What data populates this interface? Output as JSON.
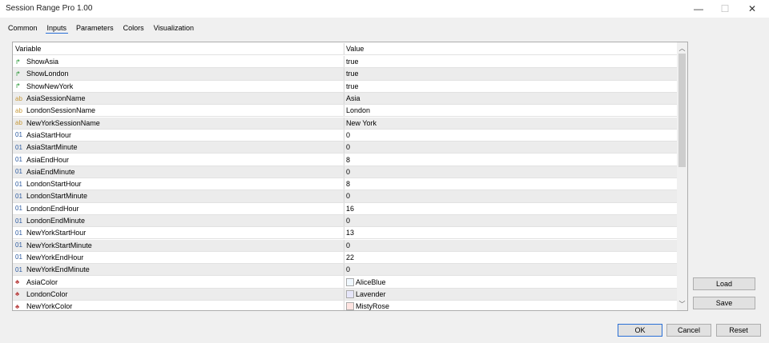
{
  "window": {
    "title": "Session Range Pro 1.00"
  },
  "tabs": [
    "Common",
    "Inputs",
    "Parameters",
    "Colors",
    "Visualization"
  ],
  "table": {
    "headers": [
      "Variable",
      "Value"
    ],
    "rows": [
      {
        "type": "bool",
        "icon": "↱",
        "name": "ShowAsia",
        "value": "true"
      },
      {
        "type": "bool",
        "icon": "↱",
        "name": "ShowLondon",
        "value": "true"
      },
      {
        "type": "bool",
        "icon": "↱",
        "name": "ShowNewYork",
        "value": "true"
      },
      {
        "type": "str",
        "icon": "ab",
        "name": "AsiaSessionName",
        "value": "Asia"
      },
      {
        "type": "str",
        "icon": "ab",
        "name": "LondonSessionName",
        "value": "London"
      },
      {
        "type": "str",
        "icon": "ab",
        "name": "NewYorkSessionName",
        "value": "New York"
      },
      {
        "type": "int",
        "icon": "01",
        "name": "AsiaStartHour",
        "value": "0"
      },
      {
        "type": "int",
        "icon": "01",
        "name": "AsiaStartMinute",
        "value": "0"
      },
      {
        "type": "int",
        "icon": "01",
        "name": "AsiaEndHour",
        "value": "8"
      },
      {
        "type": "int",
        "icon": "01",
        "name": "AsiaEndMinute",
        "value": "0"
      },
      {
        "type": "int",
        "icon": "01",
        "name": "LondonStartHour",
        "value": "8"
      },
      {
        "type": "int",
        "icon": "01",
        "name": "LondonStartMinute",
        "value": "0"
      },
      {
        "type": "int",
        "icon": "01",
        "name": "LondonEndHour",
        "value": "16"
      },
      {
        "type": "int",
        "icon": "01",
        "name": "LondonEndMinute",
        "value": "0"
      },
      {
        "type": "int",
        "icon": "01",
        "name": "NewYorkStartHour",
        "value": "13"
      },
      {
        "type": "int",
        "icon": "01",
        "name": "NewYorkStartMinute",
        "value": "0"
      },
      {
        "type": "int",
        "icon": "01",
        "name": "NewYorkEndHour",
        "value": "22"
      },
      {
        "type": "int",
        "icon": "01",
        "name": "NewYorkEndMinute",
        "value": "0"
      },
      {
        "type": "col",
        "icon": "♣",
        "name": "AsiaColor",
        "value": "AliceBlue",
        "swatch": "#f0f8ff"
      },
      {
        "type": "col",
        "icon": "♣",
        "name": "LondonColor",
        "value": "Lavender",
        "swatch": "#e6e6fa"
      },
      {
        "type": "col",
        "icon": "♣",
        "name": "NewYorkColor",
        "value": "MistyRose",
        "swatch": "#ffe4e1"
      }
    ]
  },
  "buttons": {
    "load": "Load",
    "save": "Save",
    "ok": "OK",
    "cancel": "Cancel",
    "reset": "Reset"
  }
}
